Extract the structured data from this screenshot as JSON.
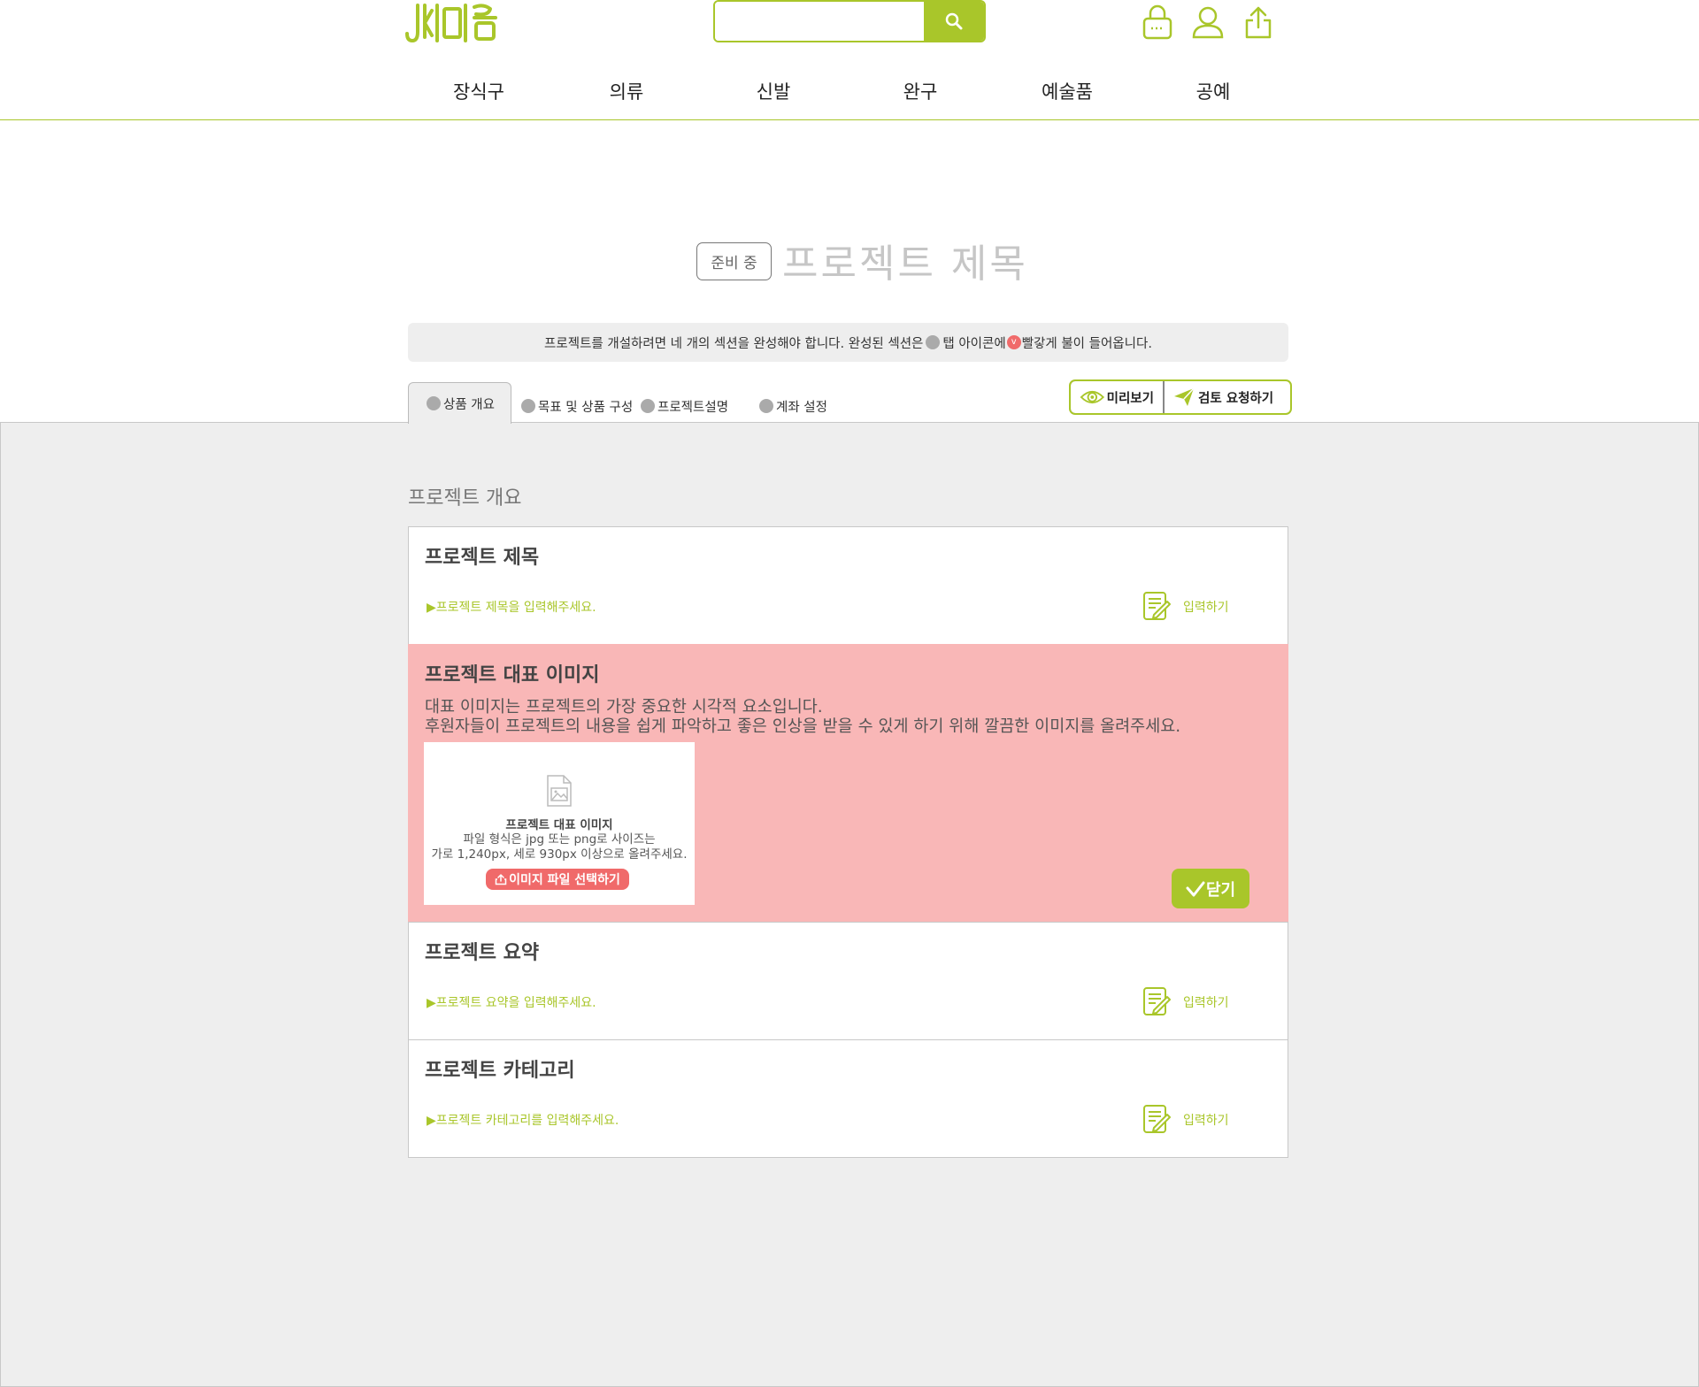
{
  "header": {
    "search": {
      "placeholder": ""
    },
    "icons": [
      "lock-icon",
      "user-icon",
      "share-icon"
    ],
    "nav": [
      "장식구",
      "의류",
      "신발",
      "완구",
      "예술품",
      "공예"
    ]
  },
  "title": {
    "status_badge": "준비 중",
    "project_title": "프로젝트 제목"
  },
  "info_bar": {
    "text_before": "프로젝트를 개설하려면 네 개의 섹션을 완성해야 합니다. 완성된 섹션은",
    "text_middle": " 탭 아이콘에 ",
    "text_after": "빨갛게 불이 들어옵니다.",
    "check_mark": "v"
  },
  "tabs": [
    {
      "label": "상품 개요",
      "active": true
    },
    {
      "label": "목표 및 상품 구성",
      "active": false
    },
    {
      "label": "프로젝트설명",
      "active": false
    },
    {
      "label": "계좌 설정",
      "active": false
    }
  ],
  "actions": {
    "preview": "미리보기",
    "review": "검토 요청하기"
  },
  "section": {
    "heading": "프로젝트 개요",
    "edit_label": "입력하기",
    "cards": {
      "title": {
        "title": "프로젝트 제목",
        "hint": "▶프로젝트 제목을 입력해주세요."
      },
      "image": {
        "title": "프로젝트 대표 이미지",
        "desc_1": "대표 이미지는 프로젝트의 가장 중요한 시각적 요소입니다.",
        "desc_2": "후원자들이 프로젝트의 내용을 쉽게 파악하고 좋은 인상을 받을 수 있게 하기 위해 깔끔한 이미지를 올려주세요.",
        "upload_title": "프로젝트 대표 이미지",
        "upload_desc_1": "파일 형식은 jpg 또는 png로 사이즈는",
        "upload_desc_2": "가로 1,240px, 세로 930px 이상으로 올려주세요.",
        "upload_button": "이미지 파일 선택하기",
        "close_button": "닫기"
      },
      "summary": {
        "title": "프로젝트 요약",
        "hint": "▶프로젝트 요약을 입력해주세요."
      },
      "category": {
        "title": "프로젝트 카테고리",
        "hint": "▶프로젝트 카테고리를 입력해주세요."
      }
    }
  },
  "colors": {
    "accent": "#a9c62a",
    "pink": "#f9b7b7",
    "red": "#f06a6a",
    "panel": "#eeeeee"
  }
}
